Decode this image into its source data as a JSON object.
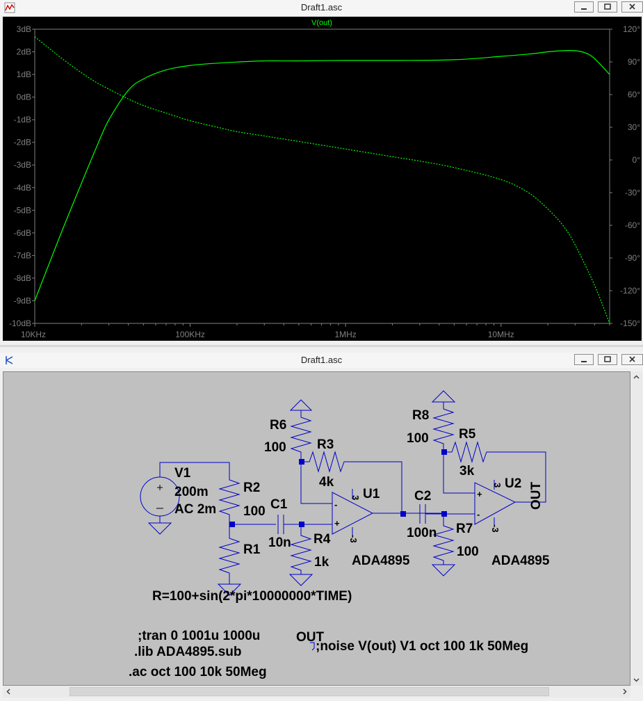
{
  "plot_window": {
    "title": "Draft1.asc",
    "trace_label": "V(out)"
  },
  "schematic_window": {
    "title": "Draft1.asc",
    "labels": {
      "v1_name": "V1",
      "v1_dc": "200m",
      "v1_ac": "AC 2m",
      "r2_name": "R2",
      "r2_val": "100",
      "r1_name": "R1",
      "r1_expr": "R=100+sin(2*pi*10000000*TIME)",
      "c1_name": "C1",
      "c1_val": "10n",
      "r4_name": "R4",
      "r4_val": "1k",
      "r6_name": "R6",
      "r6_val": "100",
      "r3_name": "R3",
      "r3_val": "4k",
      "u1_name": "U1",
      "u1_model": "ADA4895",
      "c2_name": "C2",
      "c2_val": "100n",
      "r7_name": "R7",
      "r7_val": "100",
      "r8_name": "R8",
      "r8_val": "100",
      "r5_name": "R5",
      "r5_val": "3k",
      "u2_name": "U2",
      "u2_model": "ADA4895",
      "out_label": "OUT",
      "pin3": "3",
      "pin_neg3": "-3",
      "plus": "+",
      "minus": "-"
    },
    "directives": {
      "tran": ";tran 0 1001u 1000u",
      "lib": ".lib ADA4895.sub",
      "ac": ".ac oct 100 10k 50Meg",
      "out_flag": "OUT",
      "noise": ";noise V(out) V1 oct 100 1k 50Meg"
    }
  },
  "chart_data": {
    "type": "line",
    "title": "V(out)",
    "xscale": "log",
    "xlim": [
      10000,
      50000000
    ],
    "x_ticks": [
      "10KHz",
      "100KHz",
      "1MHz",
      "10MHz"
    ],
    "ylim": [
      -10,
      3
    ],
    "y_ticks": [
      "3dB",
      "2dB",
      "1dB",
      "0dB",
      "-1dB",
      "-2dB",
      "-3dB",
      "-4dB",
      "-5dB",
      "-6dB",
      "-7dB",
      "-8dB",
      "-9dB",
      "-10dB"
    ],
    "y2lim": [
      -150,
      120
    ],
    "y2_ticks": [
      "120°",
      "90°",
      "60°",
      "30°",
      "0°",
      "-30°",
      "-60°",
      "-90°",
      "-120°",
      "-150°"
    ],
    "grid": false,
    "color": "#00ff00",
    "series": [
      {
        "style": "solid",
        "axis": "left",
        "x": [
          10000,
          12000,
          15000,
          20000,
          25000,
          30000,
          40000,
          50000,
          70000,
          100000,
          150000,
          200000,
          300000,
          500000,
          1000000,
          2000000,
          5000000,
          10000000,
          15000000,
          20000000,
          25000000,
          30000000,
          35000000,
          40000000,
          50000000
        ],
        "values": [
          -9.0,
          -7.6,
          -5.9,
          -3.8,
          -2.2,
          -1.0,
          0.3,
          0.8,
          1.2,
          1.4,
          1.5,
          1.55,
          1.6,
          1.6,
          1.62,
          1.62,
          1.65,
          1.8,
          1.9,
          2.0,
          2.05,
          2.05,
          1.95,
          1.7,
          1.0
        ]
      },
      {
        "style": "dashed",
        "axis": "right",
        "x": [
          10000,
          12000,
          15000,
          20000,
          25000,
          30000,
          40000,
          50000,
          70000,
          100000,
          150000,
          200000,
          300000,
          500000,
          1000000,
          2000000,
          3000000,
          5000000,
          10000000,
          15000000,
          20000000,
          25000000,
          30000000,
          40000000,
          50000000
        ],
        "values": [
          113,
          104,
          93,
          80,
          71,
          65,
          56,
          50,
          43,
          36,
          30,
          26,
          22,
          17,
          10,
          3,
          -1,
          -7,
          -18,
          -30,
          -45,
          -60,
          -78,
          -115,
          -150
        ]
      }
    ]
  }
}
